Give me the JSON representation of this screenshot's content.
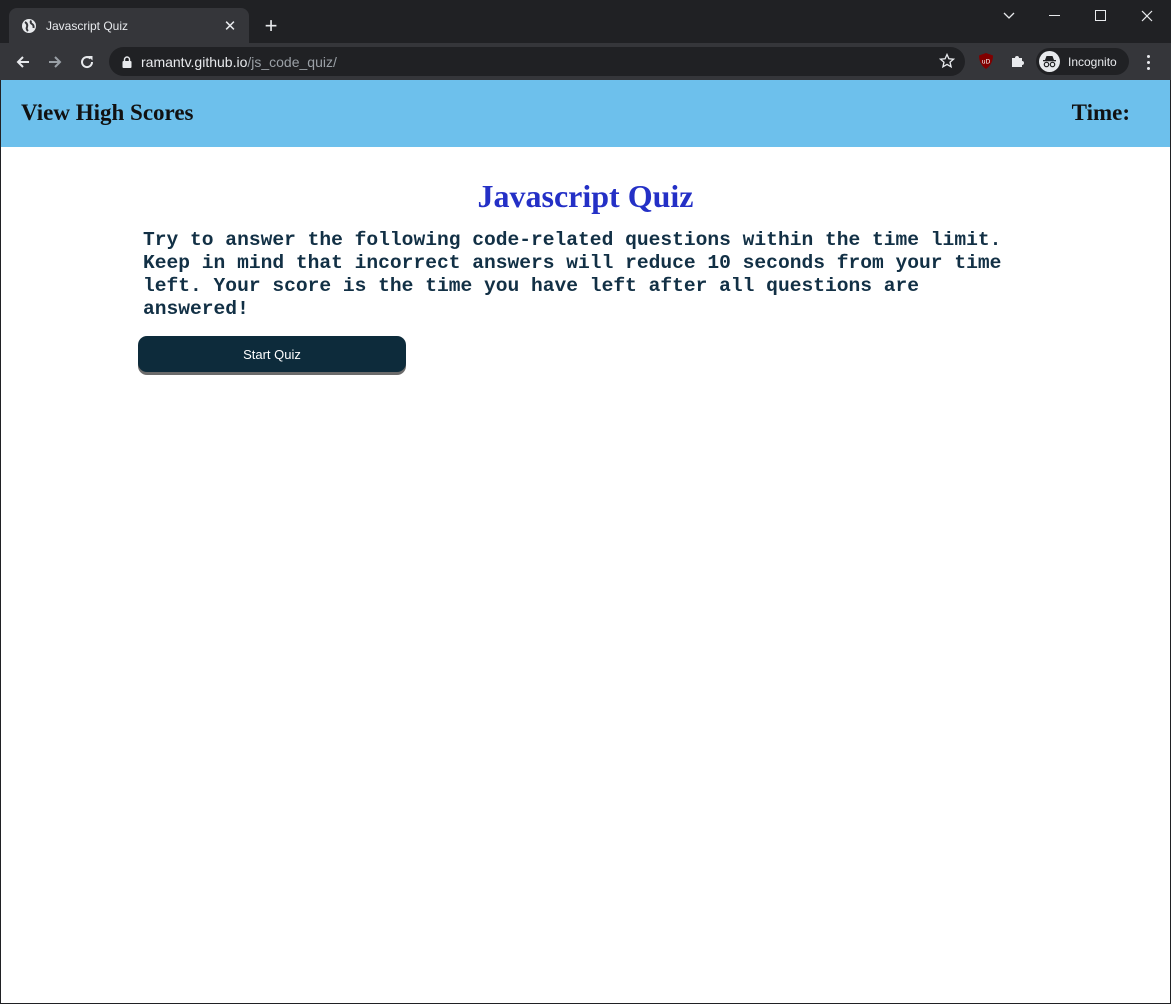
{
  "browser": {
    "tab": {
      "title": "Javascript Quiz"
    },
    "address": {
      "host": "ramantv.github.io",
      "path": "/js_code_quiz/"
    },
    "profile": {
      "label": "Incognito"
    },
    "extension_badge": "uD"
  },
  "page": {
    "header": {
      "high_scores_label": "View High Scores",
      "timer_label": "Time:"
    },
    "title": "Javascript Quiz",
    "intro_lines": [
      "Try to answer the following code-related questions within the time limit.",
      "Keep in mind that incorrect answers will reduce 10 seconds from your time",
      "left. Your score is the time you have left after all questions are",
      "answered!"
    ],
    "start_button_label": "Start Quiz"
  },
  "colors": {
    "header_bg": "#6dc0ec",
    "title": "#2430c6",
    "button_bg": "#0d2b3b"
  }
}
